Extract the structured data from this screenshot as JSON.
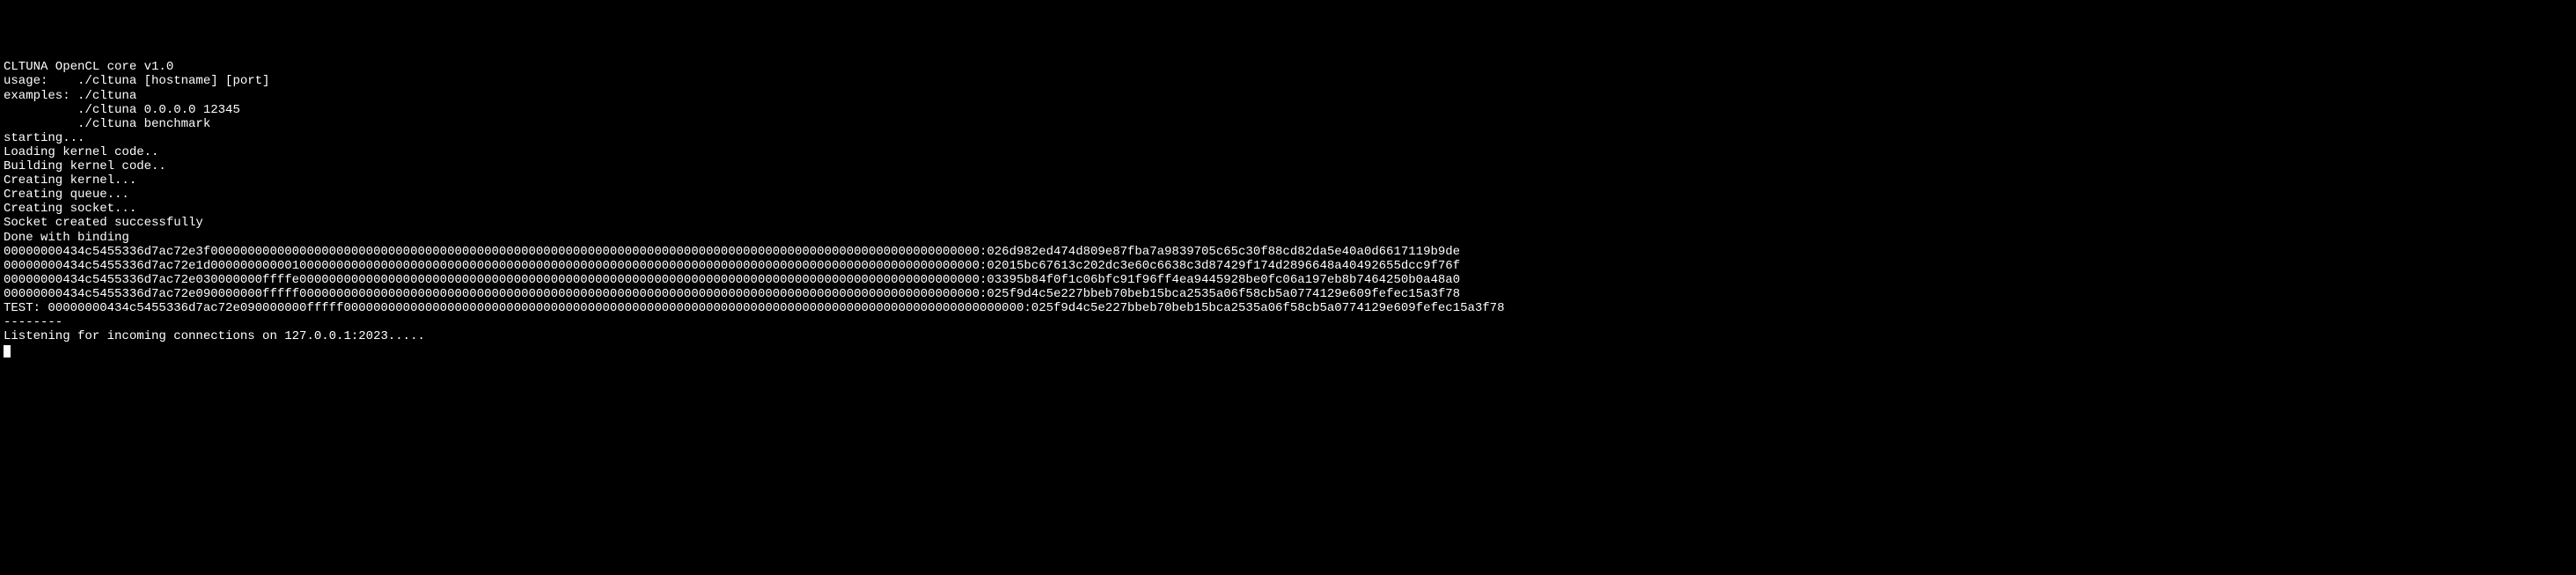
{
  "terminal": {
    "lines": [
      "CLTUNA OpenCL core v1.0",
      "usage:    ./cltuna [hostname] [port]",
      "examples: ./cltuna",
      "          ./cltuna 0.0.0.0 12345",
      "",
      "          ./cltuna benchmark",
      "starting...",
      "Loading kernel code..",
      "Building kernel code..",
      "Creating kernel...",
      "Creating queue...",
      "Creating socket...",
      "Socket created successfully",
      "Done with binding",
      "00000000434c5455336d7ac72e3f00000000000000000000000000000000000000000000000000000000000000000000000000000000000000000000000000000000:026d982ed474d809e87fba7a9839705c65c30f88cd82da5e40a0d6617119b9de",
      "00000000434c5455336d7ac72e1d00000000000100000000000000000000000000000000000000000000000000000000000000000000000000000000000000000000:02015bc67613c202dc3e60c6638c3d87429f174d2896648a40492655dcc9f76f",
      "00000000434c5455336d7ac72e030000000ffffe00000000000000000000000000000000000000000000000000000000000000000000000000000000000000000000:03395b84f0f1c06bfc91f96ff4ea9445928be0fc06a197eb8b7464250b0a48a0",
      "00000000434c5455336d7ac72e090000000fffff00000000000000000000000000000000000000000000000000000000000000000000000000000000000000000000:025f9d4c5e227bbeb70beb15bca2535a06f58cb5a0774129e609fefec15a3f78",
      "TEST: 00000000434c5455336d7ac72e090000000fffff00000000000000000000000000000000000000000000000000000000000000000000000000000000000000000000:025f9d4c5e227bbeb70beb15bca2535a06f58cb5a0774129e609fefec15a3f78",
      "--------",
      "",
      "Listening for incoming connections on 127.0.0.1:2023....."
    ]
  }
}
